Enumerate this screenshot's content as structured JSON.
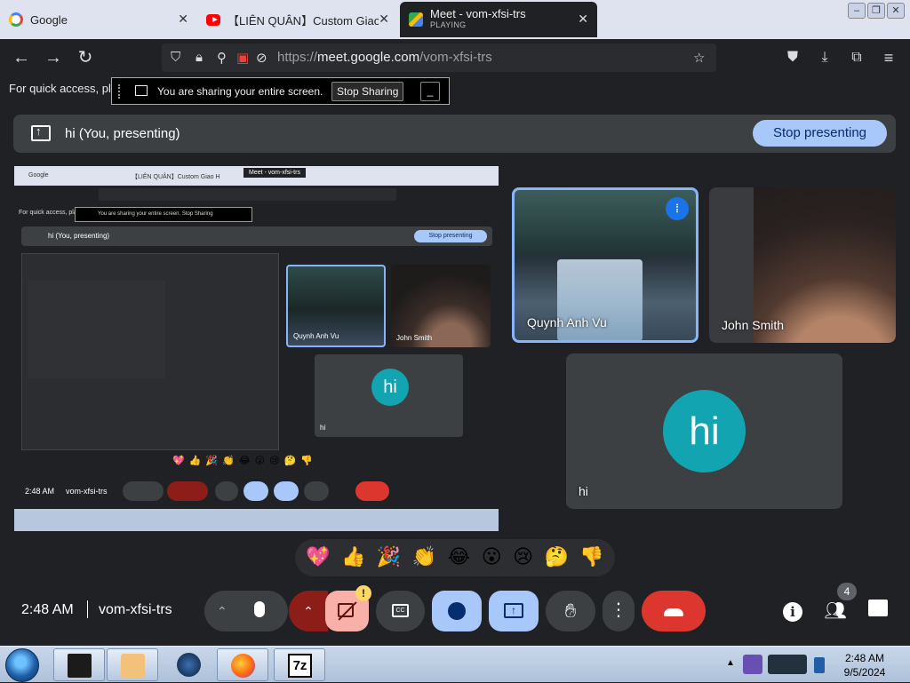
{
  "browser": {
    "tabs": [
      {
        "title": "Google",
        "icon": "google-icon"
      },
      {
        "title": "【LIÊN QUÂN】Custom Giao H",
        "icon": "youtube-icon"
      },
      {
        "title": "Meet - vom-xfsi-trs",
        "subtitle": "PLAYING",
        "icon": "meet-icon"
      }
    ],
    "url_prefix": "https://",
    "url_domain": "meet.google.com",
    "url_path": "/vom-xfsi-trs",
    "quick_access": "For quick access, plac"
  },
  "share_notice": {
    "message": "You are sharing your entire screen.",
    "stop_label": "Stop Sharing",
    "minimize_label": "_"
  },
  "presenting": {
    "label": "hi (You, presenting)",
    "stop_label": "Stop presenting"
  },
  "shared_screen": {
    "tab_google": "Google",
    "tab_yt": "【LIÊN QUÂN】Custom Giao H",
    "tab_meet": "Meet - vom-xfsi-trs",
    "quick": "For quick access, plac",
    "share_msg": "You are sharing your entire screen.   Stop Sharing",
    "present_label": "hi (You, presenting)",
    "stop_label": "Stop presenting",
    "tile_a_name": "Quynh Anh Vu",
    "tile_b_name": "John Smith",
    "tile_c_name": "hi",
    "avatar": "hi",
    "emojis": "💖👍🎉👏😂😮😢🤔👎",
    "time": "2:48 AM",
    "code": "vom-xfsi-trs"
  },
  "participants": [
    {
      "name": "Quynh Anh Vu",
      "speaking": true
    },
    {
      "name": "John Smith",
      "speaking": false
    },
    {
      "name": "hi",
      "avatar_letter": "hi",
      "avatar_color": "#12a4b1"
    }
  ],
  "reactions": [
    "💖",
    "👍",
    "🎉",
    "👏",
    "😂",
    "😮",
    "😢",
    "🤔",
    "👎"
  ],
  "meeting": {
    "time": "2:48 AM",
    "code": "vom-xfsi-trs",
    "people_count": "4",
    "camera_warning": "!",
    "cc_label": "CC"
  },
  "taskbar": {
    "time": "2:48 AM",
    "date": "9/5/2024",
    "apps": [
      "cube-app-icon",
      "media-player-icon",
      "globe-icon",
      "firefox-icon",
      "7zip-icon"
    ],
    "zip_label": "7z"
  }
}
